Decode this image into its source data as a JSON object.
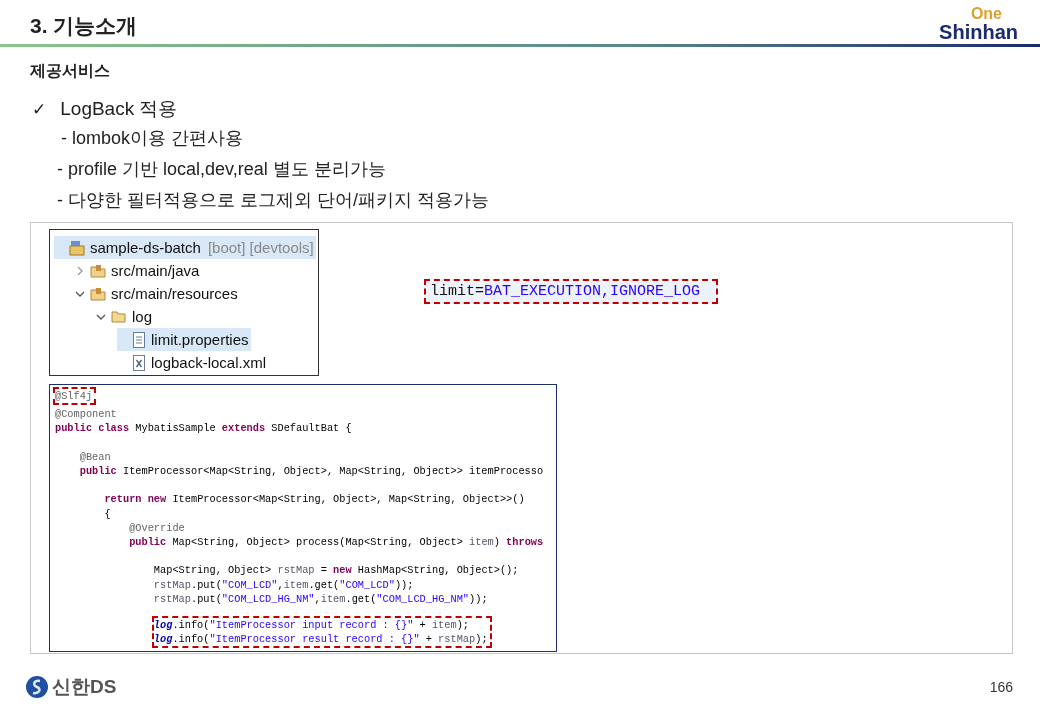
{
  "header": {
    "title": "3. 기능소개",
    "logo_top": "One",
    "logo_bottom": "Shinhan"
  },
  "section_title": "제공서비스",
  "bullet": {
    "mark": "✓",
    "text": "LogBack 적용",
    "subitems": [
      "- lombok이용 간편사용",
      "- profile 기반 local,dev,real 별도 분리가능",
      "- 다양한 필터적용으로 로그제외 단어/패키지 적용가능"
    ]
  },
  "explorer": {
    "items": [
      {
        "label": "sample-ds-batch",
        "suffix": "[boot] [devtools]",
        "kind": "project",
        "selected": true,
        "children": [
          {
            "label": "src/main/java",
            "kind": "package",
            "expanded": false,
            "selected": false
          },
          {
            "label": "src/main/resources",
            "kind": "package",
            "expanded": true,
            "selected": false,
            "children": [
              {
                "label": "log",
                "kind": "folder",
                "expanded": true,
                "selected": false,
                "children": [
                  {
                    "label": "limit.properties",
                    "kind": "text",
                    "selected": true
                  },
                  {
                    "label": "logback-local.xml",
                    "kind": "xml",
                    "selected": false
                  }
                ]
              }
            ]
          }
        ]
      }
    ]
  },
  "properties_line": {
    "key": "limit",
    "sep": "=",
    "value": "BAT_EXECUTION,IGNORE_LOG",
    "highlighted": true
  },
  "code": {
    "blocks": [
      {
        "highlighted": true,
        "blank_before": false,
        "lines": [
          {
            "blank_before": false,
            "tokens": [
              {
                "kind": "ann",
                "text": "@Slf4j"
              }
            ]
          }
        ]
      },
      {
        "highlighted": false,
        "blank_before": false,
        "lines": [
          {
            "blank_before": false,
            "tokens": [
              {
                "kind": "ann",
                "text": "@Component"
              }
            ]
          },
          {
            "blank_before": false,
            "tokens": [
              {
                "kind": "kw",
                "text": "public"
              },
              {
                "kind": "kw",
                "text": " class"
              },
              {
                "kind": "plain",
                "text": " MybatisSample"
              },
              {
                "kind": "kw",
                "text": " extends"
              },
              {
                "kind": "plain",
                "text": " SDefaultBat {"
              }
            ]
          },
          {
            "blank_before": true,
            "tokens": [
              {
                "kind": "ann",
                "text": "    @Bean"
              }
            ]
          },
          {
            "blank_before": false,
            "tokens": [
              {
                "kind": "kw",
                "text": "    public"
              },
              {
                "kind": "plain",
                "text": " ItemProcessor<Map<String, Object>, Map<String, Object>> itemProcesso"
              }
            ]
          },
          {
            "blank_before": true,
            "tokens": [
              {
                "kind": "kw",
                "text": "        return"
              },
              {
                "kind": "kw",
                "text": " new"
              },
              {
                "kind": "plain",
                "text": " ItemProcessor<Map<String, Object>, Map<String, Object>>()"
              }
            ]
          },
          {
            "blank_before": false,
            "tokens": [
              {
                "kind": "plain",
                "text": "        {"
              }
            ]
          },
          {
            "blank_before": false,
            "tokens": [
              {
                "kind": "ann",
                "text": "            @Override"
              }
            ]
          },
          {
            "blank_before": false,
            "tokens": [
              {
                "kind": "kw",
                "text": "            public"
              },
              {
                "kind": "plain",
                "text": " Map<String, Object> process(Map<String, Object>"
              },
              {
                "kind": "var",
                "text": " item"
              },
              {
                "kind": "plain",
                "text": ")"
              },
              {
                "kind": "kw",
                "text": " throws"
              }
            ]
          },
          {
            "blank_before": true,
            "tokens": [
              {
                "kind": "plain",
                "text": "                Map<String, Object>"
              },
              {
                "kind": "var",
                "text": " rstMap"
              },
              {
                "kind": "plain",
                "text": " ="
              },
              {
                "kind": "kw",
                "text": " new"
              },
              {
                "kind": "plain",
                "text": " HashMap<String, Object>();"
              }
            ]
          },
          {
            "blank_before": false,
            "tokens": [
              {
                "kind": "var",
                "text": "                rstMap"
              },
              {
                "kind": "plain",
                "text": ".put("
              },
              {
                "kind": "str",
                "text": "\"COM_LCD\""
              },
              {
                "kind": "plain",
                "text": ","
              },
              {
                "kind": "var",
                "text": "item"
              },
              {
                "kind": "plain",
                "text": ".get("
              },
              {
                "kind": "str",
                "text": "\"COM_LCD\""
              },
              {
                "kind": "plain",
                "text": "));"
              }
            ]
          },
          {
            "blank_before": false,
            "tokens": [
              {
                "kind": "var",
                "text": "                rstMap"
              },
              {
                "kind": "plain",
                "text": ".put("
              },
              {
                "kind": "str",
                "text": "\"COM_LCD_HG_NM\""
              },
              {
                "kind": "plain",
                "text": ","
              },
              {
                "kind": "var",
                "text": "item"
              },
              {
                "kind": "plain",
                "text": ".get("
              },
              {
                "kind": "str",
                "text": "\"COM_LCD_HG_NM\""
              },
              {
                "kind": "plain",
                "text": "));"
              }
            ]
          }
        ]
      },
      {
        "highlighted": true,
        "blank_before": true,
        "lines": [
          {
            "blank_before": false,
            "tokens": [
              {
                "kind": "log",
                "text": "log"
              },
              {
                "kind": "plain",
                "text": ".info("
              },
              {
                "kind": "str",
                "text": "\"ItemProcessor input record : {}\""
              },
              {
                "kind": "plain",
                "text": " +"
              },
              {
                "kind": "var",
                "text": " item"
              },
              {
                "kind": "plain",
                "text": ");"
              }
            ]
          },
          {
            "blank_before": false,
            "tokens": [
              {
                "kind": "log",
                "text": "log"
              },
              {
                "kind": "plain",
                "text": ".info("
              },
              {
                "kind": "str",
                "text": "\"ItemProcessor result record : {}\""
              },
              {
                "kind": "plain",
                "text": " +"
              },
              {
                "kind": "var",
                "text": " rstMap"
              },
              {
                "kind": "plain",
                "text": ");"
              }
            ]
          }
        ]
      }
    ]
  },
  "footer": {
    "logo": "신한DS",
    "page": "166"
  }
}
